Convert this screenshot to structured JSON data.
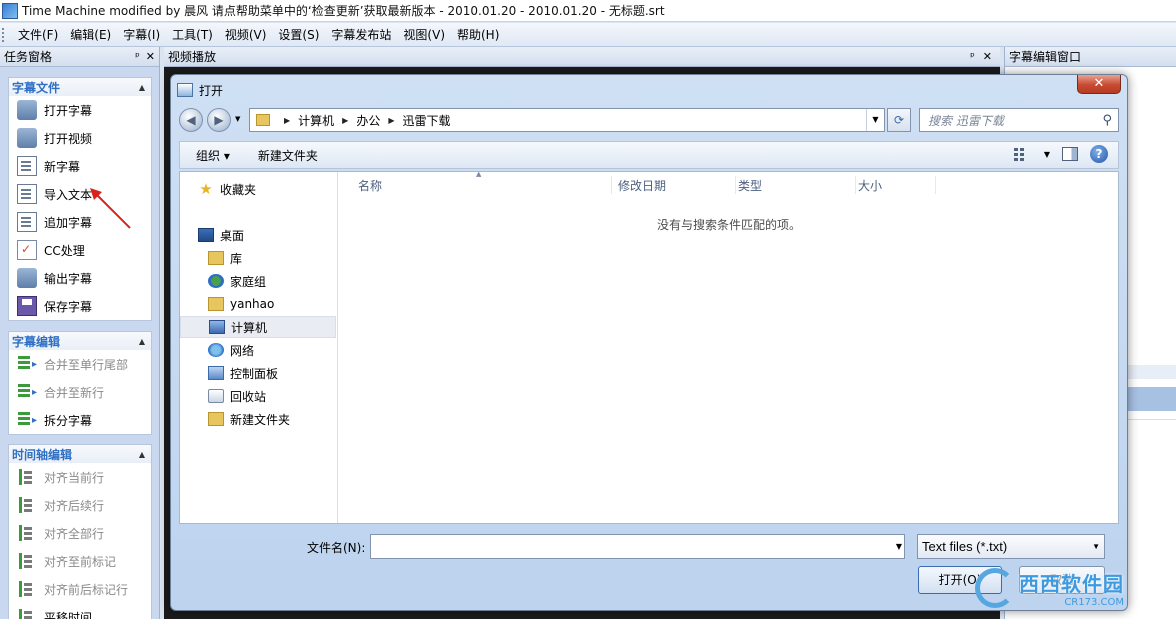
{
  "window": {
    "title": "Time Machine modified by 晨风 请点帮助菜单中的‘检查更新’获取最新版本 - 2010.01.20 - 2010.01.20 - 无标题.srt"
  },
  "menu": [
    "文件(F)",
    "编辑(E)",
    "字幕(I)",
    "工具(T)",
    "视频(V)",
    "设置(S)",
    "字幕发布站",
    "视图(V)",
    "帮助(H)"
  ],
  "task_pane": {
    "title": "任务窗格",
    "pin": "ᵖ",
    "close": "✕",
    "groups": [
      {
        "title": "字幕文件",
        "items": [
          {
            "label": "打开字幕",
            "icon": "open-subtitle-icon",
            "disabled": false
          },
          {
            "label": "打开视频",
            "icon": "open-video-icon",
            "disabled": false
          },
          {
            "label": "新字幕",
            "icon": "new-subtitle-icon",
            "disabled": false
          },
          {
            "label": "导入文本",
            "icon": "import-text-icon",
            "disabled": false
          },
          {
            "label": "追加字幕",
            "icon": "append-subtitle-icon",
            "disabled": false
          },
          {
            "label": "CC处理",
            "icon": "cc-process-icon",
            "disabled": false
          },
          {
            "label": "输出字幕",
            "icon": "export-subtitle-icon",
            "disabled": false
          },
          {
            "label": "保存字幕",
            "icon": "save-icon",
            "disabled": false
          }
        ]
      },
      {
        "title": "字幕编辑",
        "items": [
          {
            "label": "合并至单行尾部",
            "icon": "merge-line-end-icon",
            "disabled": true
          },
          {
            "label": "合并至新行",
            "icon": "merge-new-line-icon",
            "disabled": true
          },
          {
            "label": "拆分字幕",
            "icon": "split-subtitle-icon",
            "disabled": false
          }
        ]
      },
      {
        "title": "时间轴编辑",
        "items": [
          {
            "label": "对齐当前行",
            "icon": "align-current-icon",
            "disabled": true
          },
          {
            "label": "对齐后续行",
            "icon": "align-following-icon",
            "disabled": true
          },
          {
            "label": "对齐全部行",
            "icon": "align-all-icon",
            "disabled": true
          },
          {
            "label": "对齐至前标记",
            "icon": "align-prev-mark-icon",
            "disabled": true
          },
          {
            "label": "对齐前后标记行",
            "icon": "align-marks-icon",
            "disabled": true
          },
          {
            "label": "平移时间",
            "icon": "shift-time-icon",
            "disabled": false
          }
        ]
      }
    ]
  },
  "video_pane": {
    "title": "视频播放",
    "pin": "ᵖ",
    "close": "✕"
  },
  "edit_pane": {
    "title": "字幕编辑窗口"
  },
  "dialog": {
    "title": "打开",
    "close": "✕",
    "path": [
      "计算机",
      "办公",
      "迅雷下载"
    ],
    "search_placeholder": "搜索 迅雷下载",
    "toolbar": {
      "organize": "组织 ▾",
      "new_folder": "新建文件夹"
    },
    "nav": [
      {
        "label": "收藏夹",
        "icon": "star-icon",
        "cls": "ni-star",
        "glyph": "★",
        "selected": false
      },
      {
        "label": "桌面",
        "icon": "desktop-icon",
        "cls": "ni-desk",
        "glyph": "",
        "selected": false
      },
      {
        "label": "库",
        "icon": "library-icon",
        "cls": "ni-lib",
        "glyph": "",
        "selected": false
      },
      {
        "label": "家庭组",
        "icon": "homegroup-icon",
        "cls": "ni-home",
        "glyph": "",
        "selected": false
      },
      {
        "label": "yanhao",
        "icon": "user-folder-icon",
        "cls": "ni-user",
        "glyph": "",
        "selected": false
      },
      {
        "label": "计算机",
        "icon": "computer-icon",
        "cls": "ni-pc",
        "glyph": "",
        "selected": true
      },
      {
        "label": "网络",
        "icon": "network-icon",
        "cls": "ni-net",
        "glyph": "",
        "selected": false
      },
      {
        "label": "控制面板",
        "icon": "control-panel-icon",
        "cls": "ni-ctrl",
        "glyph": "",
        "selected": false
      },
      {
        "label": "回收站",
        "icon": "recycle-bin-icon",
        "cls": "ni-bin",
        "glyph": "",
        "selected": false
      },
      {
        "label": "新建文件夹",
        "icon": "folder-icon",
        "cls": "ni-folder",
        "glyph": "",
        "selected": false
      }
    ],
    "columns": [
      "名称",
      "修改日期",
      "类型",
      "大小"
    ],
    "empty_message": "没有与搜索条件匹配的项。",
    "filename_label": "文件名(N):",
    "filename_value": "",
    "filter": "Text files (*.txt)",
    "open_button": "打开(O)",
    "cancel_button": "取消"
  },
  "watermark": {
    "name": "西西软件园",
    "url": "CR173.COM"
  }
}
